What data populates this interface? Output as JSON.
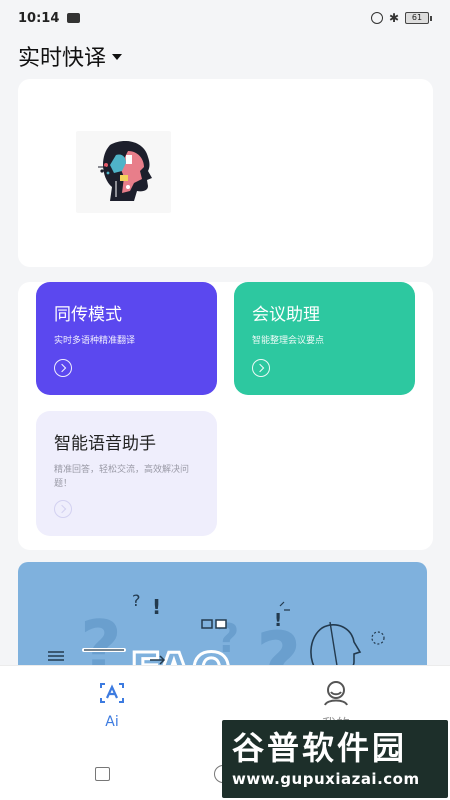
{
  "status_bar": {
    "time": "10:14",
    "battery": "61"
  },
  "header": {
    "title": "实时快译"
  },
  "features": [
    {
      "title": "同传模式",
      "desc": "实时多语种精准翻译"
    },
    {
      "title": "会议助理",
      "desc": "智能整理会议要点"
    },
    {
      "title": "智能语音助手",
      "desc": "精准回答，轻松交流，高效解决问题！"
    }
  ],
  "bottom_nav": [
    {
      "label": "Ai"
    },
    {
      "label": "我的"
    }
  ],
  "watermark": {
    "title": "谷普软件园",
    "url": "www.gupuxiazai.com"
  },
  "colors": {
    "interp_tile": "#5b48ef",
    "meeting_tile": "#2dc8a0",
    "voice_tile": "#efeefc",
    "faq_banner": "#7fb1dd",
    "accent": "#3d7be0"
  }
}
